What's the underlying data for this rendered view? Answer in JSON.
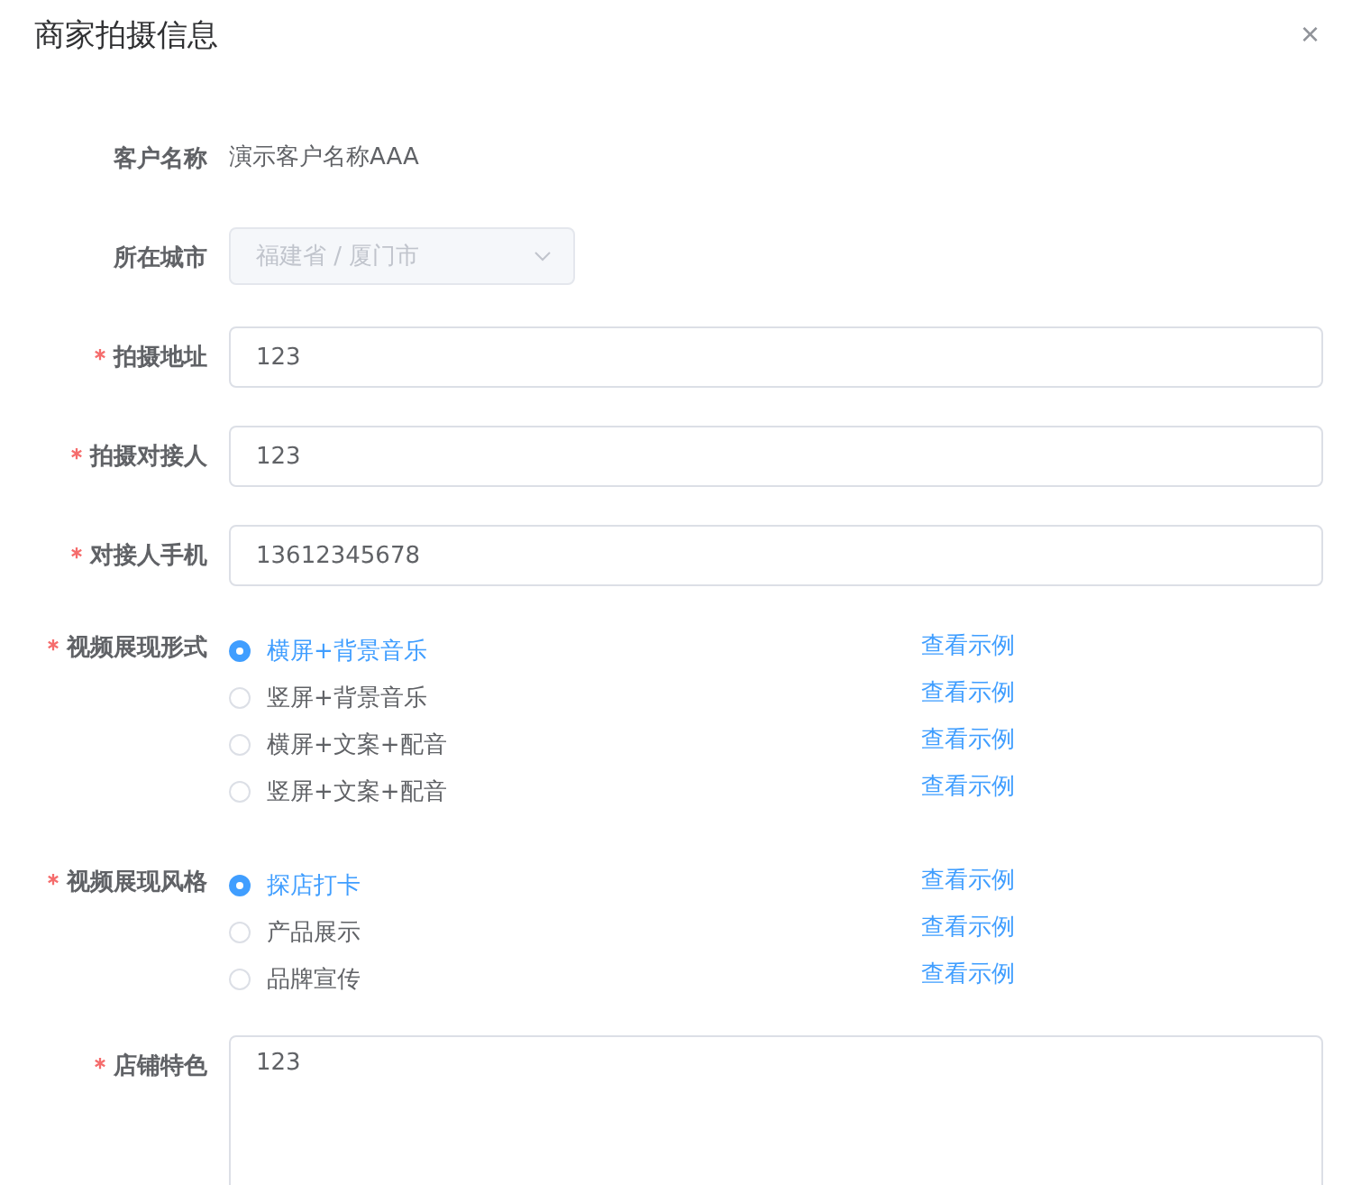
{
  "dialog": {
    "title": "商家拍摄信息",
    "close_label": "×"
  },
  "fields": [
    {
      "kind": "text",
      "label": "客户名称",
      "required": false,
      "value": "演示客户名称AAA"
    },
    {
      "kind": "select",
      "label": "所在城市",
      "required": false,
      "disabled": true,
      "value": "福建省 / 厦门市"
    },
    {
      "kind": "input",
      "label": "拍摄地址",
      "required": true,
      "value": "123"
    },
    {
      "kind": "input",
      "label": "拍摄对接人",
      "required": true,
      "value": "123"
    },
    {
      "kind": "input",
      "label": "对接人手机",
      "required": true,
      "value": "13612345678"
    },
    {
      "kind": "radio",
      "label": "视频展现形式",
      "required": true,
      "options": [
        {
          "label": "横屏+背景音乐",
          "selected": true,
          "link": "查看示例"
        },
        {
          "label": "竖屏+背景音乐",
          "selected": false,
          "link": "查看示例"
        },
        {
          "label": "横屏+文案+配音",
          "selected": false,
          "link": "查看示例"
        },
        {
          "label": "竖屏+文案+配音",
          "selected": false,
          "link": "查看示例"
        }
      ]
    },
    {
      "kind": "radio",
      "label": "视频展现风格",
      "required": true,
      "options": [
        {
          "label": "探店打卡",
          "selected": true,
          "link": "查看示例"
        },
        {
          "label": "产品展示",
          "selected": false,
          "link": "查看示例"
        },
        {
          "label": "品牌宣传",
          "selected": false,
          "link": "查看示例"
        }
      ]
    },
    {
      "kind": "textarea",
      "label": "店铺特色",
      "required": true,
      "value": "123"
    }
  ]
}
